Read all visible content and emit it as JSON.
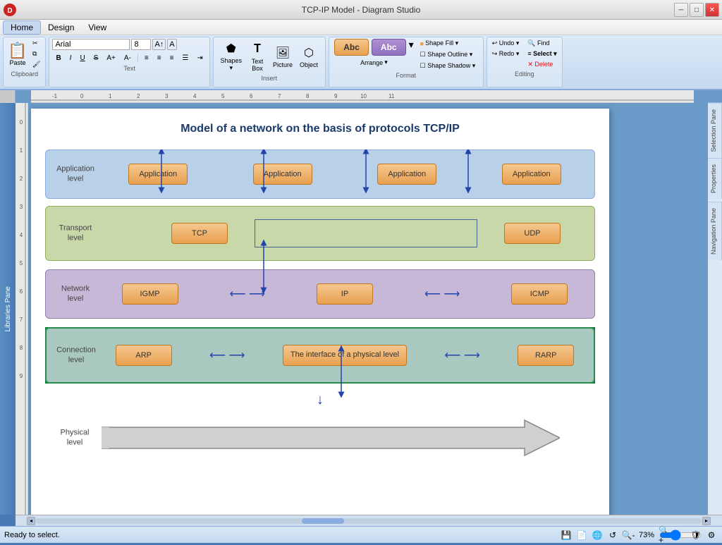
{
  "titlebar": {
    "title": "TCP-IP Model - Diagram Studio",
    "controls": [
      "minimize",
      "maximize",
      "close"
    ]
  },
  "menubar": {
    "items": [
      "Home",
      "Design",
      "View"
    ]
  },
  "ribbon": {
    "groups": [
      {
        "label": "Clipboard",
        "buttons": [
          "Paste"
        ]
      },
      {
        "label": "Text",
        "font": "Arial",
        "size": "8"
      },
      {
        "label": "Insert",
        "buttons": [
          "Shapes",
          "Text Box",
          "Picture",
          "Object"
        ]
      },
      {
        "label": "Format",
        "buttons": [
          "Arrange",
          "Shape Fill",
          "Shape Outline",
          "Shape Shadow"
        ]
      },
      {
        "label": "Editing",
        "buttons": [
          "Find",
          "Select",
          "Undo",
          "Redo",
          "Delete"
        ]
      }
    ],
    "find_label": "Find",
    "select_label": "Select",
    "undo_label": "Undo",
    "redo_label": "Redo",
    "delete_label": "Delete"
  },
  "diagram": {
    "title": "Model of a network on the basis of protocols TCP/IP",
    "layers": [
      {
        "name": "Application level",
        "type": "application",
        "protocols": [
          "Application",
          "Application",
          "Application",
          "Application"
        ]
      },
      {
        "name": "Transport level",
        "type": "transport",
        "protocols": [
          "TCP",
          "UDP"
        ]
      },
      {
        "name": "Network level",
        "type": "network",
        "protocols": [
          "IGMP",
          "IP",
          "ICMP"
        ]
      },
      {
        "name": "Connection level",
        "type": "connection",
        "protocols": [
          "ARP",
          "The interface of a physical level",
          "RARP"
        ]
      },
      {
        "name": "Physical level",
        "type": "physical",
        "protocols": []
      }
    ]
  },
  "sidebar": {
    "left_label": "Libraries Pane",
    "right_tabs": [
      "Selection Pane",
      "Properties",
      "Navigation Pane"
    ]
  },
  "statusbar": {
    "message": "Ready to select.",
    "zoom": "73%"
  }
}
